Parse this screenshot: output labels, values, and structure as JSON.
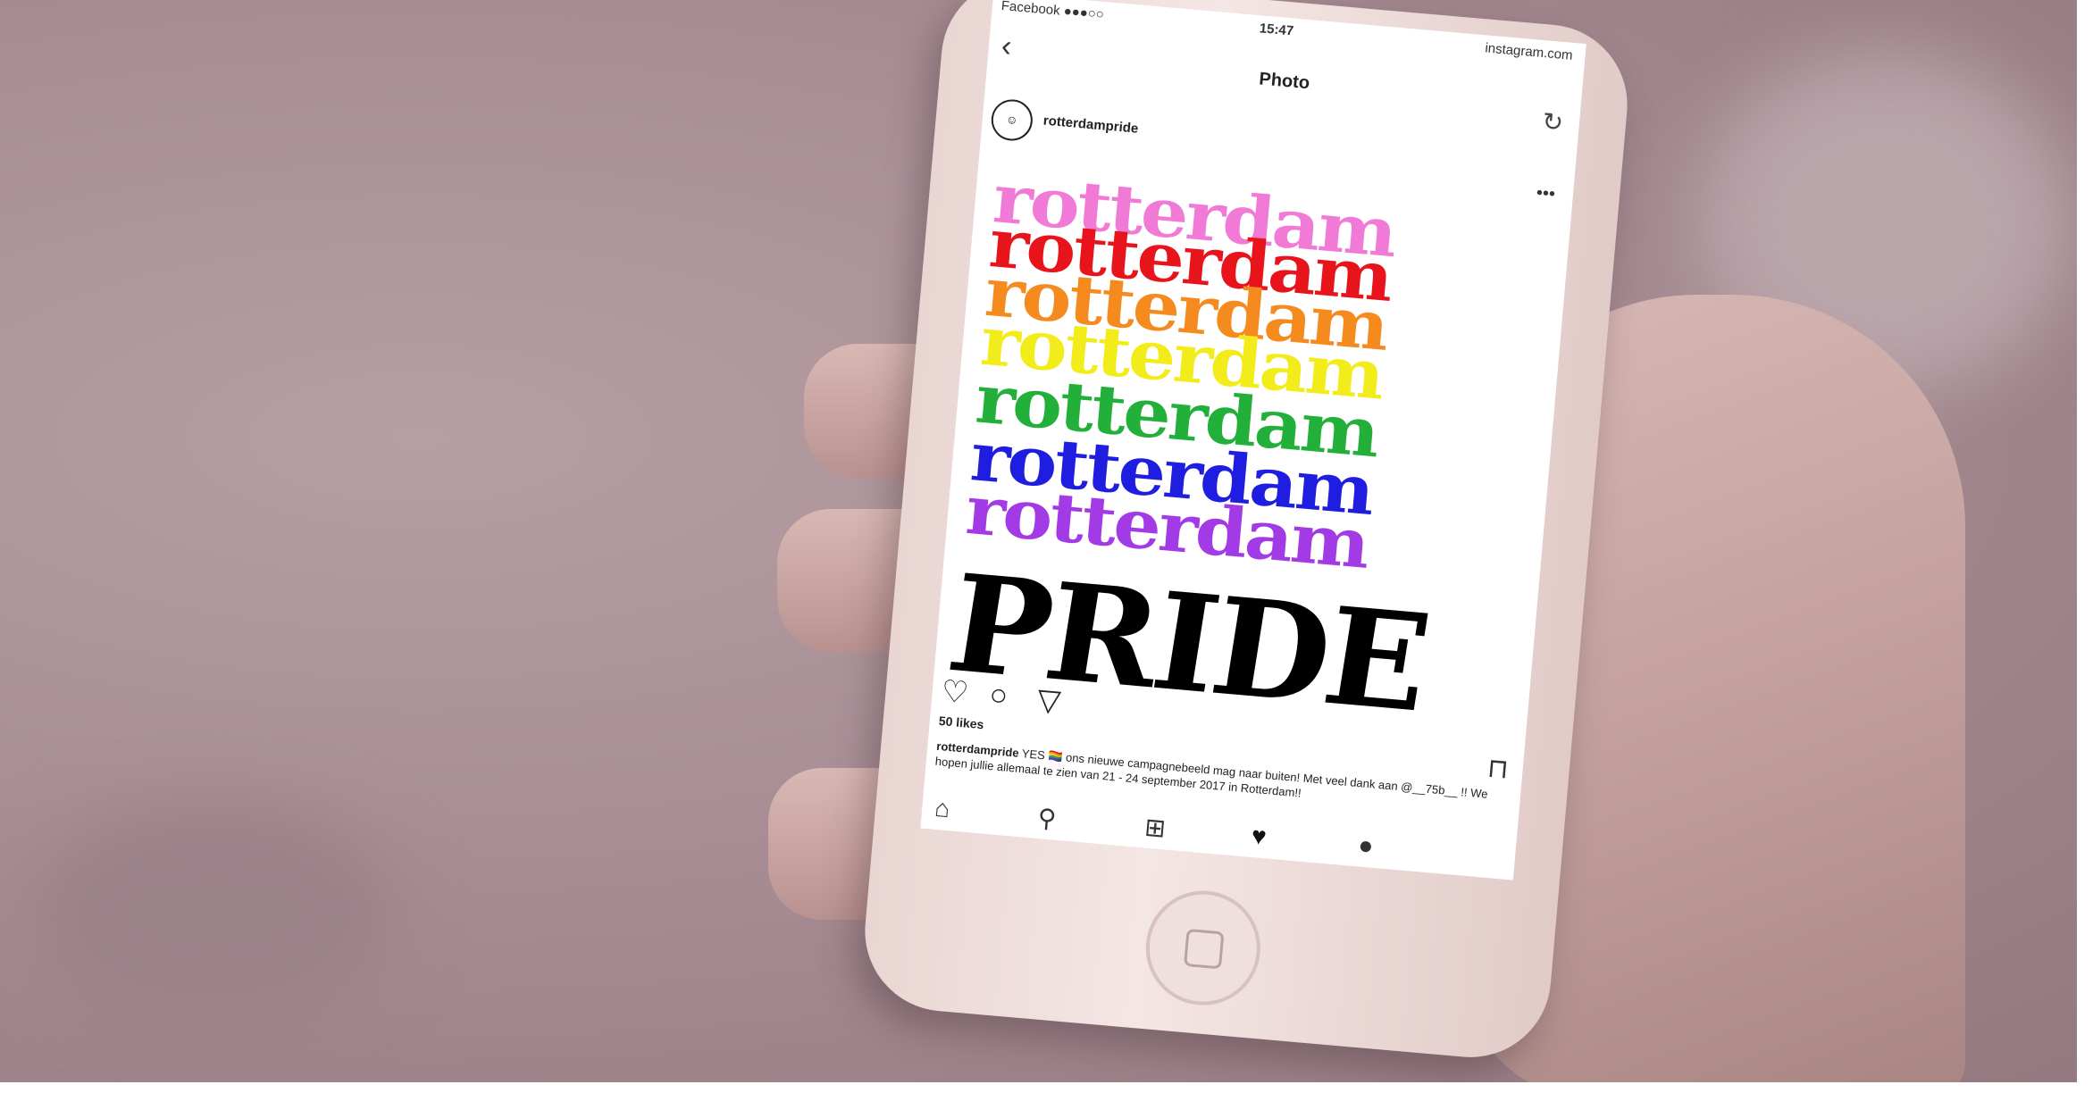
{
  "status_bar": {
    "carrier": "Facebook ●●●○○",
    "time": "15:47",
    "url": "instagram.com"
  },
  "nav": {
    "title": "Photo",
    "back_icon": "chevron-left-icon",
    "refresh_icon": "refresh-icon"
  },
  "post": {
    "username": "rotterdampride",
    "image_words": [
      "rotterdam",
      "rotterdam",
      "rotterdam",
      "rotterdam",
      "rotterdam",
      "rotterdam",
      "rotterdam"
    ],
    "image_colors": [
      "#f07ad6",
      "#e8141c",
      "#f58a1e",
      "#f2ec1a",
      "#22b03a",
      "#1f1ee0",
      "#a23be6"
    ],
    "pride_word": "PRIDE",
    "likes": "50 likes",
    "caption_user": "rotterdampride",
    "caption_text": "YES 🏳️‍🌈 ons nieuwe campagnebeeld mag naar buiten! Met veel dank aan @__75b__ !! We hopen jullie allemaal te zien van 21 - 24 september 2017 in Rotterdam!!"
  }
}
